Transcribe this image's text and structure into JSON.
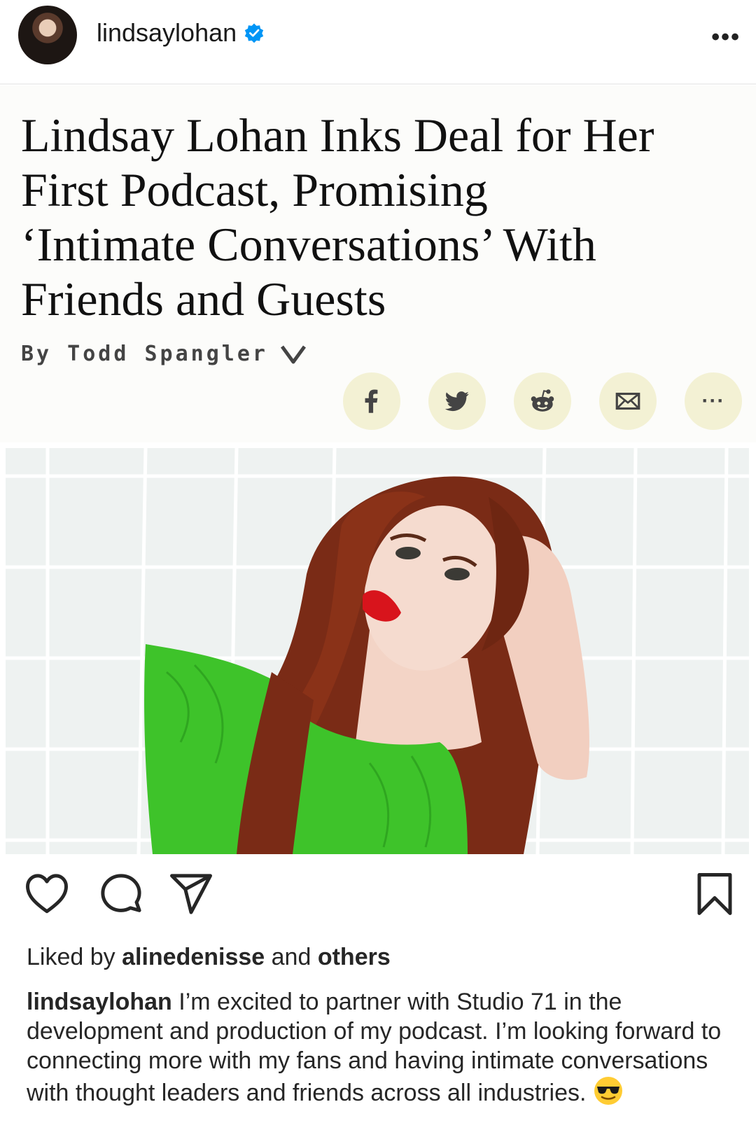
{
  "post": {
    "username": "lindsaylohan",
    "verified_icon": "verified-badge-icon",
    "more_icon": "more-horizontal-icon"
  },
  "article": {
    "headline_line1": "Lindsay Lohan Inks Deal for Her",
    "headline_line2": "First Podcast, Promising",
    "headline_line3": "‘Intimate Conversations’ With",
    "headline_line4": "Friends and Guests",
    "byline": "By Todd Spangler",
    "share_buttons": [
      "facebook-icon",
      "twitter-icon",
      "reddit-icon",
      "email-icon",
      "more-icon"
    ],
    "share_more_label": "···"
  },
  "actions": {
    "icons": [
      "heart-icon",
      "comment-icon",
      "share-icon",
      "bookmark-icon"
    ]
  },
  "likes": {
    "prefix": "Liked by ",
    "user": "alinedenisse",
    "middle": " and ",
    "others": "others"
  },
  "caption": {
    "username": "lindsaylohan",
    "text": " I’m excited to partner with Studio 71 in the development and production of my podcast. I’m looking forward to connecting more with my fans and having intimate conversations with thought leaders and friends across all industries."
  },
  "colors": {
    "verified": "#0095f6",
    "share_bg": "#f3f1d4",
    "dress": "#3ec32a",
    "hair": "#7a2b16",
    "lips": "#d8141c"
  }
}
